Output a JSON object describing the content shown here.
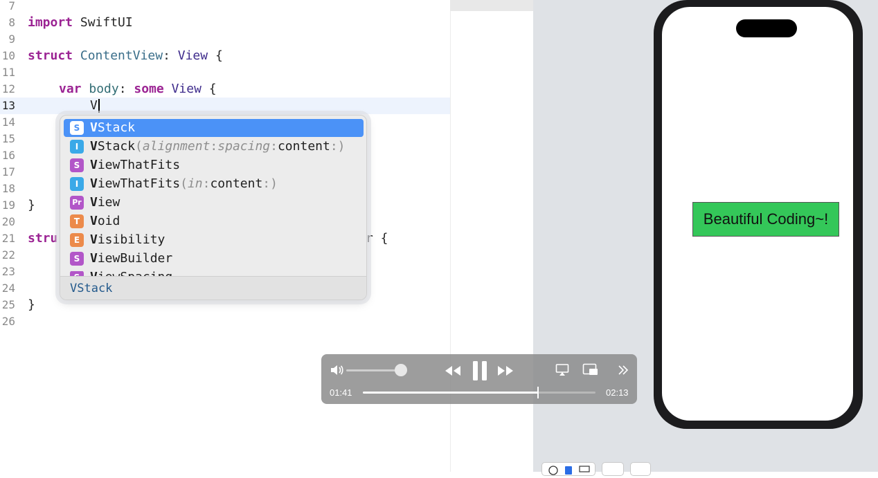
{
  "editor": {
    "lines": [
      {
        "num": "7"
      },
      {
        "num": "8"
      },
      {
        "num": "9"
      },
      {
        "num": "10"
      },
      {
        "num": "11"
      },
      {
        "num": "12"
      },
      {
        "num": "13"
      },
      {
        "num": "14"
      },
      {
        "num": "15"
      },
      {
        "num": "16"
      },
      {
        "num": "17"
      },
      {
        "num": "18"
      },
      {
        "num": "19"
      },
      {
        "num": "20"
      },
      {
        "num": "21"
      },
      {
        "num": "22"
      },
      {
        "num": "23"
      },
      {
        "num": "24"
      },
      {
        "num": "25"
      },
      {
        "num": "26"
      }
    ],
    "code": {
      "import_kw": "import",
      "import_name": " SwiftUI",
      "struct_kw": "struct",
      "struct_name": " ContentView",
      "struct_rest_colon": ":",
      "struct_view": " View",
      "struct_brace": " {",
      "var_kw": "var",
      "body_name": " body",
      "colon": ":",
      "some_kw": " some",
      "view_type": " View",
      "open_brace": " {",
      "typed": "V",
      "close_19": "}",
      "struct2_kw": "stru",
      "struct2_tail": "r {",
      "close_25": "}"
    }
  },
  "autocomplete": {
    "items": [
      {
        "badge": "S",
        "color": "#b256c8",
        "bold": "V",
        "rest": "Stack",
        "args": ""
      },
      {
        "badge": "I",
        "color": "#3aa9e8",
        "bold": "V",
        "rest": "Stack",
        "args_open": "(",
        "arg1": "alignment",
        "sep1": ":",
        "arg2": "spacing",
        "sep2": ":",
        "arg3": "content",
        "args_close": ":)"
      },
      {
        "badge": "S",
        "color": "#b256c8",
        "bold": "V",
        "rest": "iewThatFits"
      },
      {
        "badge": "I",
        "color": "#3aa9e8",
        "bold": "V",
        "rest": "iewThatFits",
        "args_open": "(",
        "arg1": "in",
        "sep1": ":",
        "arg3": "content",
        "args_close": ":)"
      },
      {
        "badge": "Pr",
        "color": "#b256c8",
        "bold": "V",
        "rest": "iew"
      },
      {
        "badge": "T",
        "color": "#ec8a4a",
        "bold": "V",
        "rest": "oid"
      },
      {
        "badge": "E",
        "color": "#ec8a4a",
        "bold": "V",
        "rest": "isibility"
      },
      {
        "badge": "S",
        "color": "#b256c8",
        "bold": "V",
        "rest": "iewBuilder"
      },
      {
        "badge": "S",
        "color": "#b256c8",
        "bold": "V",
        "rest": "iewSpacing"
      }
    ],
    "footer": "VStack"
  },
  "preview": {
    "button_text": "Beautiful Coding~!",
    "button_color": "#34c759"
  },
  "player": {
    "current_time": "01:41",
    "total_time": "02:13",
    "progress": 0.753,
    "volume": 0.9,
    "icons": [
      "speaker-icon",
      "rewind-icon",
      "pause-icon",
      "fast-forward-icon",
      "airplay-icon",
      "picture-in-picture-icon",
      "chevron-double-right-icon"
    ]
  }
}
